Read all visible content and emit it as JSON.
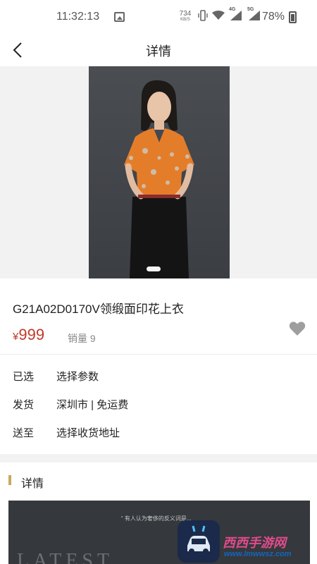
{
  "status": {
    "time": "11:32:13",
    "speed_value": "734",
    "speed_unit": "KB/S",
    "net1": "4G",
    "net2": "5G",
    "battery": "78%"
  },
  "nav": {
    "title": "详情"
  },
  "product": {
    "name": "G21A02D0170V领缎面印花上衣",
    "currency": "¥",
    "price": "999",
    "sales_label": "销量 9",
    "gallery_current": 1
  },
  "options": [
    {
      "label": "已选",
      "value": "选择参数"
    },
    {
      "label": "发货",
      "value": "深圳市 | 免运费"
    },
    {
      "label": "送至",
      "value": "选择收货地址"
    }
  ],
  "details": {
    "title": "详情",
    "image_text": "LATEST",
    "caption": "“ 有人认为奢侈的反义词是..."
  },
  "watermark": {
    "text": "西西手游网",
    "url": "www.lmwwsz.com"
  },
  "colors": {
    "price": "#c0392b",
    "accent": "#c9a85d",
    "heart": "#9e9e9e"
  }
}
